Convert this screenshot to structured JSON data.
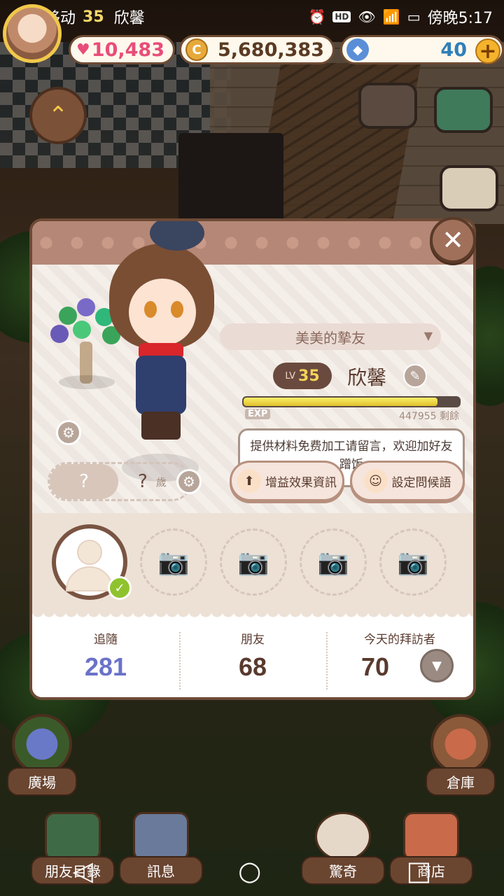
{
  "status_bar": {
    "carrier": "中国移动",
    "game_level": "35",
    "player_name": "欣馨",
    "time": "傍晚5:17"
  },
  "currency": {
    "hearts": "10,483",
    "gold": "5,680,383",
    "gems": "40",
    "add_label": "+"
  },
  "profile": {
    "relation_label": "美美的摯友",
    "level_prefix": "LV",
    "level": "35",
    "name": "欣馨",
    "exp_label": "EXP",
    "exp_fraction": 0.9,
    "exp_remaining_value": "447955",
    "exp_remaining_suffix": "剩餘",
    "greeting_message": "提供材料免费加工请留言，欢迎加好友蹭饭",
    "age_value": "?",
    "age_unit": "歲",
    "buff_button_label": "增益效果資訊",
    "greeting_button_label": "設定問候語"
  },
  "stats": {
    "followers_label": "追隨",
    "followers_value": "281",
    "friends_label": "朋友",
    "friends_value": "68",
    "visitors_label": "今天的拜訪者",
    "visitors_value": "70"
  },
  "bottom_nav": {
    "square": "廣場",
    "storage": "倉庫",
    "friends_list": "朋友目錄",
    "messages": "訊息",
    "surprise": "驚奇",
    "shop": "商店"
  },
  "colors": {
    "modal_border": "#6d4a36",
    "followers_accent": "#6a72c8",
    "heart_accent": "#e84d7a",
    "exp_fill": "#f9ef6a"
  }
}
